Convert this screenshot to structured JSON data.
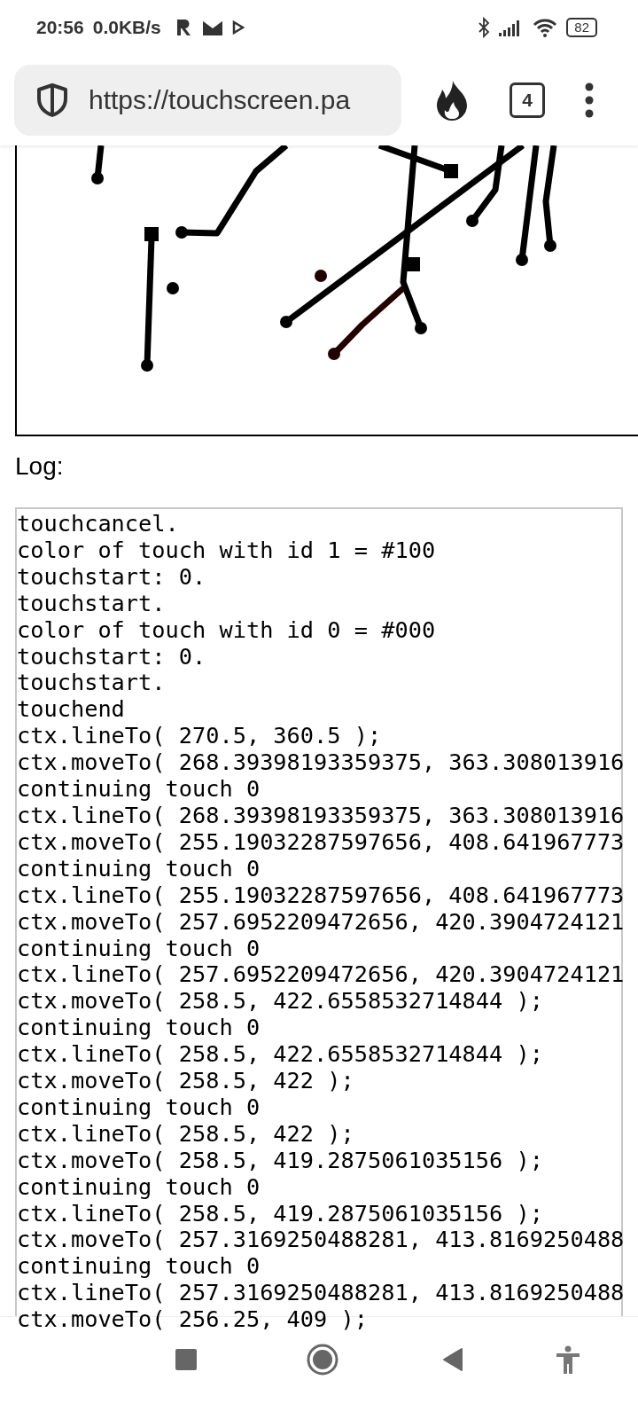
{
  "status_bar": {
    "time": "20:56",
    "net_speed": "0.0KB/s",
    "battery": "82"
  },
  "browser": {
    "url": "https://touchscreen.pa",
    "tab_count": "4"
  },
  "log": {
    "label": "Log:",
    "lines": [
      "touchcancel.",
      "color of touch with id 1 = #100",
      "touchstart: 0.",
      "touchstart.",
      "color of touch with id 0 = #000",
      "touchstart: 0.",
      "touchstart.",
      "touchend",
      "ctx.lineTo( 270.5, 360.5 );",
      "ctx.moveTo( 268.39398193359375, 363.308013916",
      "continuing touch 0",
      "ctx.lineTo( 268.39398193359375, 363.308013916",
      "ctx.moveTo( 255.19032287597656, 408.641967773",
      "continuing touch 0",
      "ctx.lineTo( 255.19032287597656, 408.641967773",
      "ctx.moveTo( 257.6952209472656, 420.3904724121",
      "continuing touch 0",
      "ctx.lineTo( 257.6952209472656, 420.3904724121",
      "ctx.moveTo( 258.5, 422.6558532714844 );",
      "continuing touch 0",
      "ctx.lineTo( 258.5, 422.6558532714844 );",
      "ctx.moveTo( 258.5, 422 );",
      "continuing touch 0",
      "ctx.lineTo( 258.5, 422 );",
      "ctx.moveTo( 258.5, 419.2875061035156 );",
      "continuing touch 0",
      "ctx.lineTo( 258.5, 419.2875061035156 );",
      "ctx.moveTo( 257.3169250488281, 413.8169250488",
      "continuing touch 0",
      "ctx.lineTo( 257.3169250488281, 413.8169250488",
      "ctx.moveTo( 256.25, 409 );"
    ]
  }
}
